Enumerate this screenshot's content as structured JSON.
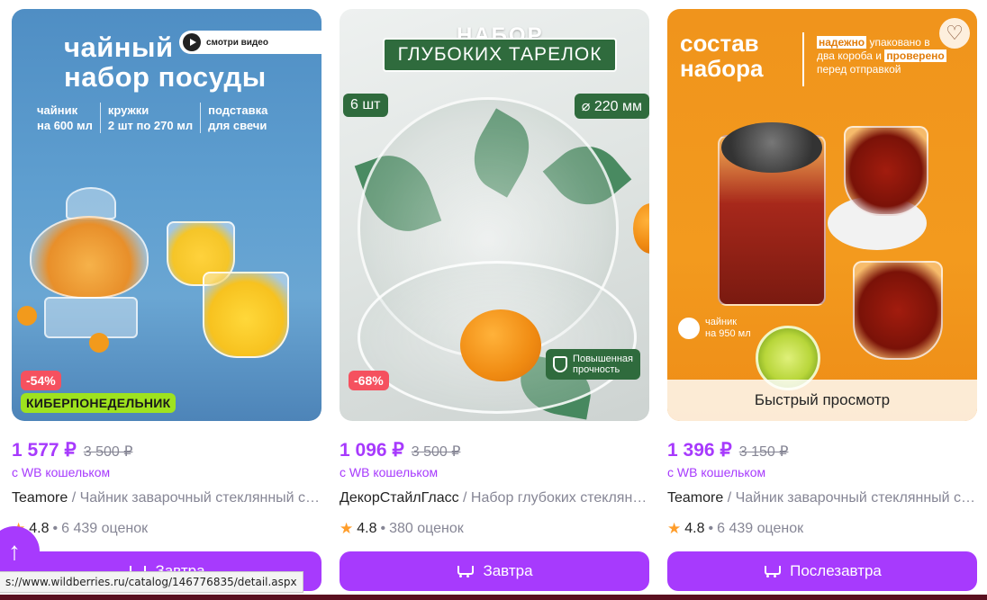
{
  "colors": {
    "accent": "#a73afd",
    "discount": "#f5515f",
    "promo": "#9ee21e",
    "muted": "#868695"
  },
  "products": [
    {
      "image": {
        "title_line1": "чайный",
        "title_line2": "набор посуды",
        "video_label": "смотри видео",
        "specs": [
          {
            "line1": "чайник",
            "line2": "на 600 мл"
          },
          {
            "line1": "кружки",
            "line2": "2 шт по 270 мл"
          },
          {
            "line1": "подставка",
            "line2": "для свечи"
          }
        ]
      },
      "discount": "-54%",
      "promo_badge": "КИБЕРПОНЕДЕЛЬНИК",
      "price": "1 577 ₽",
      "old_price": "3 500 ₽",
      "wallet_note": "с WB кошельком",
      "brand": "Teamore",
      "title": " / Чайник заварочный стеклянный с подставкой",
      "rating": "4.8",
      "reviews": "6 439 оценок",
      "button_label": "Завтра"
    },
    {
      "image": {
        "title_top": "НАБОР",
        "title_box": "ГЛУБОКИХ ТАРЕЛОК",
        "qty": "6 шт",
        "diameter": "⌀ 220 мм",
        "strength_line1": "Повышенная",
        "strength_line2": "прочность"
      },
      "discount": "-68%",
      "price": "1 096 ₽",
      "old_price": "3 500 ₽",
      "wallet_note": "с WB кошельком",
      "brand": "ДекорСтайлГласс",
      "title": " / Набор глубоких стеклянных тарелок",
      "rating": "4.8",
      "reviews": "380 оценок",
      "button_label": "Завтра"
    },
    {
      "image": {
        "title_line1": "состав",
        "title_line2": "набора",
        "note_hl1": "надежно",
        "note_part1": " упаковано в",
        "note_line2a": "два короба и ",
        "note_hl2": "проверено",
        "note_line3": "перед отправкой",
        "kettle_line1": "чайник",
        "kettle_line2": "на 950 мл"
      },
      "quick_view": "Быстрый просмотр",
      "price": "1 396 ₽",
      "old_price": "3 150 ₽",
      "wallet_note": "с WB кошельком",
      "brand": "Teamore",
      "title": " / Чайник заварочный стеклянный с ситом",
      "rating": "4.8",
      "reviews": "6 439 оценок",
      "button_label": "Послезавтра"
    }
  ],
  "status_url": "s://www.wildberries.ru/catalog/146776835/detail.aspx",
  "scroll_top_icon": "arrow-up-icon"
}
